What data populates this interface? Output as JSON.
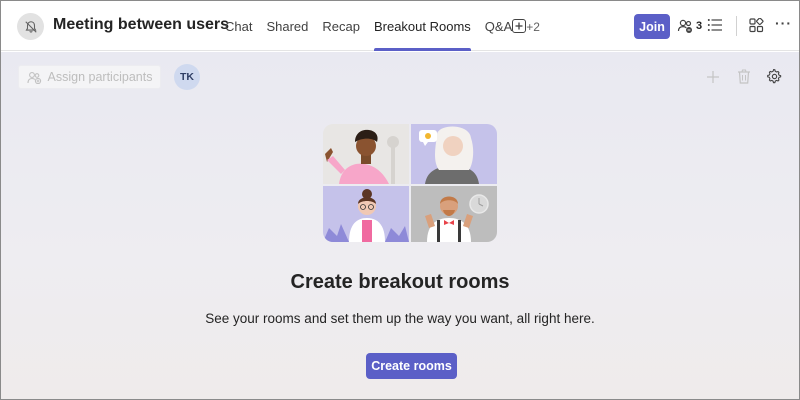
{
  "header": {
    "title": "Meeting between users",
    "tabs": [
      {
        "label": "Chat"
      },
      {
        "label": "Shared"
      },
      {
        "label": "Recap"
      },
      {
        "label": "Breakout Rooms",
        "active": true
      },
      {
        "label": "Q&A"
      }
    ],
    "more_tabs": "+2",
    "join_label": "Join",
    "participant_count": "3",
    "icons": {
      "meeting": "bell-off-icon",
      "add_tab": "plus-box-icon",
      "people": "people-icon",
      "list": "list-icon",
      "apps": "apps-icon",
      "more": "more-icon"
    }
  },
  "toolbar": {
    "assign_label": "Assign participants",
    "avatar_initials": "TK",
    "icons": [
      "add-icon",
      "trash-icon",
      "gear-icon"
    ]
  },
  "empty_state": {
    "title": "Create breakout rooms",
    "description": "See your rooms and set them up the way you want, all right here.",
    "button_label": "Create rooms"
  },
  "colors": {
    "accent": "#5b5fc7",
    "background": "#ebeaf1"
  }
}
